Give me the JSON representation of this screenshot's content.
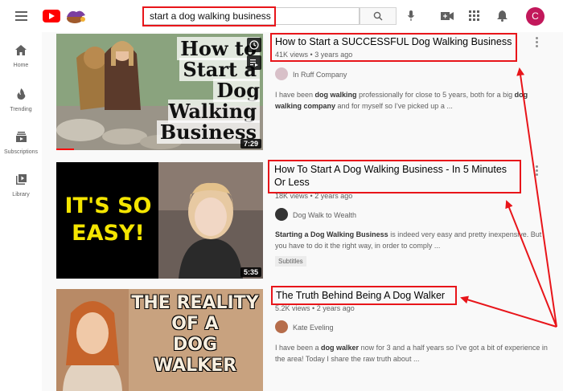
{
  "search": {
    "query": "start a dog walking business"
  },
  "user": {
    "initial": "C",
    "avatar_color": "#c2185b"
  },
  "sidebar": {
    "items": [
      {
        "label": "Home",
        "icon": "home-icon"
      },
      {
        "label": "Trending",
        "icon": "flame-icon"
      },
      {
        "label": "Subscriptions",
        "icon": "subscriptions-icon"
      },
      {
        "label": "Library",
        "icon": "library-icon"
      }
    ]
  },
  "colors": {
    "annotation_red": "#e8151a",
    "brand_red": "#ff0000"
  },
  "results": [
    {
      "title": "How to Start a SUCCESSFUL Dog Walking Business",
      "views": "41K views",
      "age": "3 years ago",
      "channel": "In Ruff Company",
      "description_html": "I have been <b>dog walking</b> professionally for close to 5 years, both for a big <b>dog walking company</b> and for myself so I've picked up a ...",
      "duration": "7:29",
      "thumb_text": "How to Start a Dog Walking Business"
    },
    {
      "title": "How To Start A Dog Walking Business - In 5 Minutes Or Less",
      "views": "18K views",
      "age": "2 years ago",
      "channel": "Dog Walk to Wealth",
      "description_html": "<b>Starting a Dog Walking Business</b> is indeed very easy and pretty inexpensive. But you have to do it the right way, in order to comply ...",
      "duration": "5:35",
      "badge": "Subtitles",
      "thumb_text": "IT'S SO EASY!"
    },
    {
      "title": "The Truth Behind Being A Dog Walker",
      "views": "5.2K views",
      "age": "2 years ago",
      "channel": "Kate Eveling",
      "description_html": "I have been a <b>dog walker</b> now for 3 and a half years so I've got a bit of experience in the area! Today I share the raw truth about ...",
      "thumb_text": "THE REALITY OF A DOG WALKER"
    }
  ]
}
